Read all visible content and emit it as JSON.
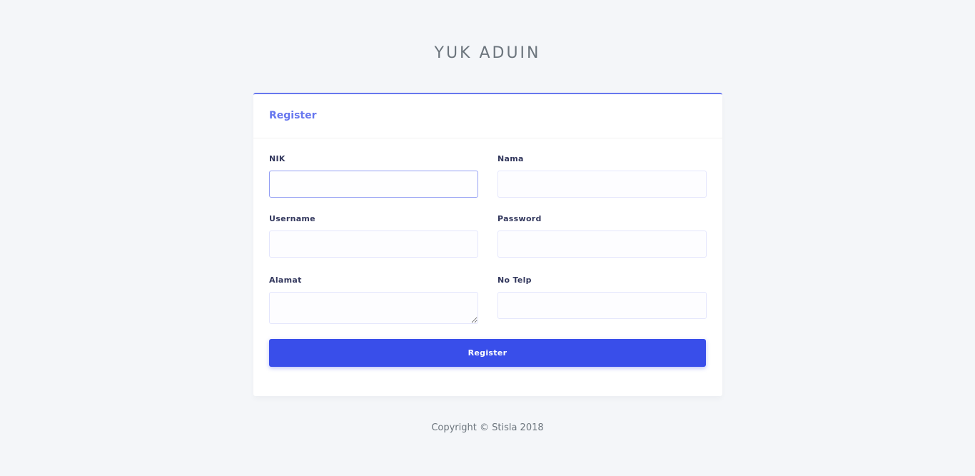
{
  "brand": {
    "title": "YUK ADUIN"
  },
  "card": {
    "title": "Register"
  },
  "form": {
    "nik": {
      "label": "NIK",
      "value": "",
      "placeholder": ""
    },
    "nama": {
      "label": "Nama",
      "value": "",
      "placeholder": ""
    },
    "username": {
      "label": "Username",
      "value": "",
      "placeholder": ""
    },
    "password": {
      "label": "Password",
      "value": "",
      "placeholder": ""
    },
    "alamat": {
      "label": "Alamat",
      "value": "",
      "placeholder": ""
    },
    "no_telp": {
      "label": "No Telp",
      "value": "",
      "placeholder": ""
    },
    "submit_label": "Register"
  },
  "footer": {
    "copyright": "Copyright © Stisla 2018"
  },
  "colors": {
    "primary": "#6777ef",
    "button": "#394eea",
    "background": "#f4f6f9"
  }
}
